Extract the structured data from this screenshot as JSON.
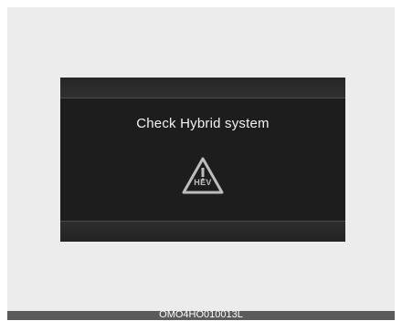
{
  "display": {
    "message": "Check Hybrid system",
    "warning_badge": "HEV",
    "icon": "hev-warning-triangle-icon"
  },
  "figure": {
    "code": "OMO4HO010013L"
  },
  "colors": {
    "display_bg": "#1d1d1d",
    "frame_bg": "#ececec",
    "caption_bg": "#5b5b5b"
  }
}
